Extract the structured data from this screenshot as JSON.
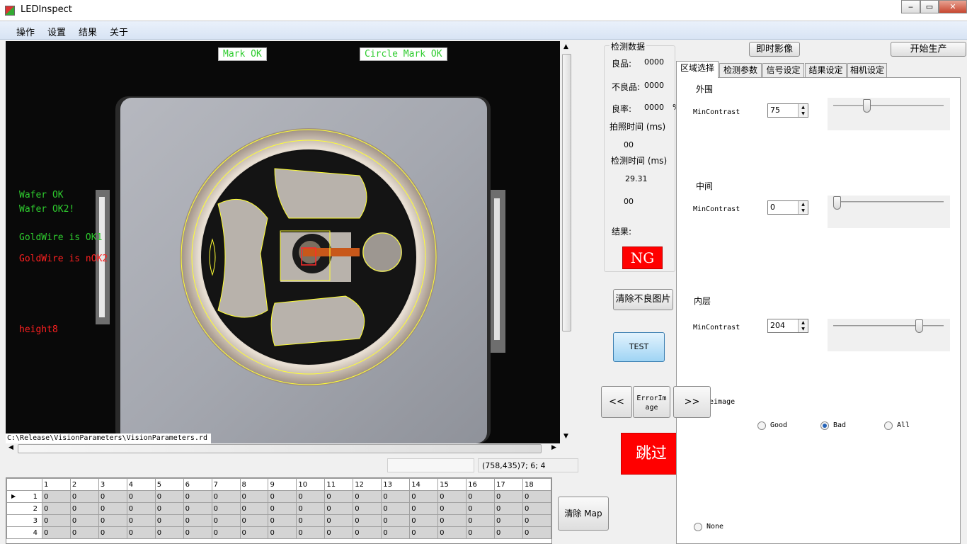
{
  "window": {
    "title": "LEDInspect",
    "minimize": "‒",
    "maximize": "▭",
    "close": "✕"
  },
  "menu": [
    "操作",
    "设置",
    "结果",
    "关于"
  ],
  "image": {
    "mark_ok": "Mark OK",
    "circle_mark_ok": "Circle Mark OK",
    "wafer_ok": "Wafer OK",
    "wafer_ok2": "Wafer OK2!",
    "goldwire_ok": "GoldWire is OK1",
    "goldwire_nok": "GoldWire is nOK2",
    "height": "height8",
    "path": "C:\\Release\\VisionParameters\\VisionParameters.rd"
  },
  "status": {
    "coords": "(758,435)7; 6; 4"
  },
  "grid": {
    "columns": [
      "1",
      "2",
      "3",
      "4",
      "5",
      "6",
      "7",
      "8",
      "9",
      "10",
      "11",
      "12",
      "13",
      "14",
      "15",
      "16",
      "17",
      "18"
    ],
    "rows": [
      {
        "num": "1",
        "cells": [
          "0",
          "0",
          "0",
          "0",
          "0",
          "0",
          "0",
          "0",
          "0",
          "0",
          "0",
          "0",
          "0",
          "0",
          "0",
          "0",
          "0",
          "0"
        ]
      },
      {
        "num": "2",
        "cells": [
          "0",
          "0",
          "0",
          "0",
          "0",
          "0",
          "0",
          "0",
          "0",
          "0",
          "0",
          "0",
          "0",
          "0",
          "0",
          "0",
          "0",
          "0"
        ]
      },
      {
        "num": "3",
        "cells": [
          "0",
          "0",
          "0",
          "0",
          "0",
          "0",
          "0",
          "0",
          "0",
          "0",
          "0",
          "0",
          "0",
          "0",
          "0",
          "0",
          "0",
          "0"
        ]
      },
      {
        "num": "4",
        "cells": [
          "0",
          "0",
          "0",
          "0",
          "0",
          "0",
          "0",
          "0",
          "0",
          "0",
          "0",
          "0",
          "0",
          "0",
          "0",
          "0",
          "0",
          "0"
        ]
      }
    ]
  },
  "clear_map": "清除 Map",
  "stats": {
    "group_title": "检测数据",
    "good_label": "良品:",
    "good_value": "0000",
    "bad_label": "不良品:",
    "bad_value": "0000",
    "rate_label": "良率:",
    "rate_value": "0000",
    "rate_unit": "%",
    "shot_time_label": "拍照时间 (ms)",
    "shot_time_value": "00",
    "detect_time_label": "检测时间 (ms)",
    "detect_time_value": "29.31",
    "extra_value": "00",
    "result_label": "结果:",
    "result_value": "NG"
  },
  "buttons": {
    "live_video": "即时影像",
    "start_production": "开始生产",
    "clear_bad_images": "清除不良图片",
    "test": "TEST",
    "prev": "<<",
    "error_image": "ErrorImage",
    "next": ">>",
    "skip": "跳过"
  },
  "tabs": [
    "区域选择",
    "检测参数",
    "信号设定",
    "结果设定",
    "相机设定"
  ],
  "region": {
    "outer_title": "外围",
    "outer_label": "MinContrast",
    "outer_value": "75",
    "outer_level": 0.29,
    "middle_title": "中间",
    "middle_label": "MinContrast",
    "middle_value": "0",
    "middle_level": 0.0,
    "inner_title": "内层",
    "inner_label": "MinContrast",
    "inner_value": "204",
    "inner_level": 0.8,
    "saveimage_label": "eimage",
    "radio_good": "Good",
    "radio_bad": "Bad",
    "radio_all": "All",
    "radio_none": "None",
    "selected_radio": "Bad"
  },
  "colors": {
    "ng_red": "#ff0000",
    "ok_green": "#2ecc2e",
    "overlay_yellow": "#ffff33"
  }
}
